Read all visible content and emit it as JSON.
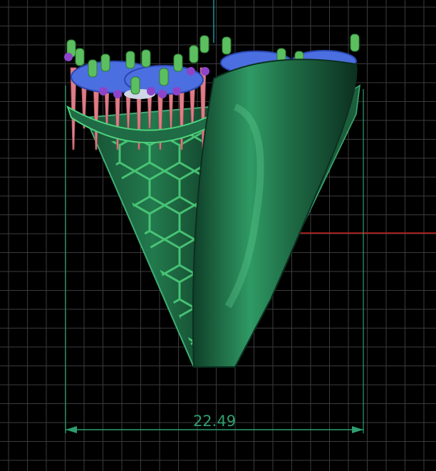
{
  "viewport": {
    "name": "cad-3d-viewport",
    "background_color": "#000000",
    "grid_color": "#3b3b3b",
    "axis_vertical_color": "#1fb7c4",
    "axis_horizontal_color": "#d02020"
  },
  "model": {
    "name": "ring-with-gem-settings",
    "body_color": "#1e6b45",
    "body_highlight_color": "#3fae73",
    "hex_pattern_color": "#4fd27c",
    "prong_color": "#e07c86",
    "setting_color": "#4b6fe0",
    "bead_color": "#5bbf5f",
    "accent_color": "#8e44c8"
  },
  "dimension": {
    "value_label": "22.49",
    "line_color": "#2f9e6f"
  }
}
